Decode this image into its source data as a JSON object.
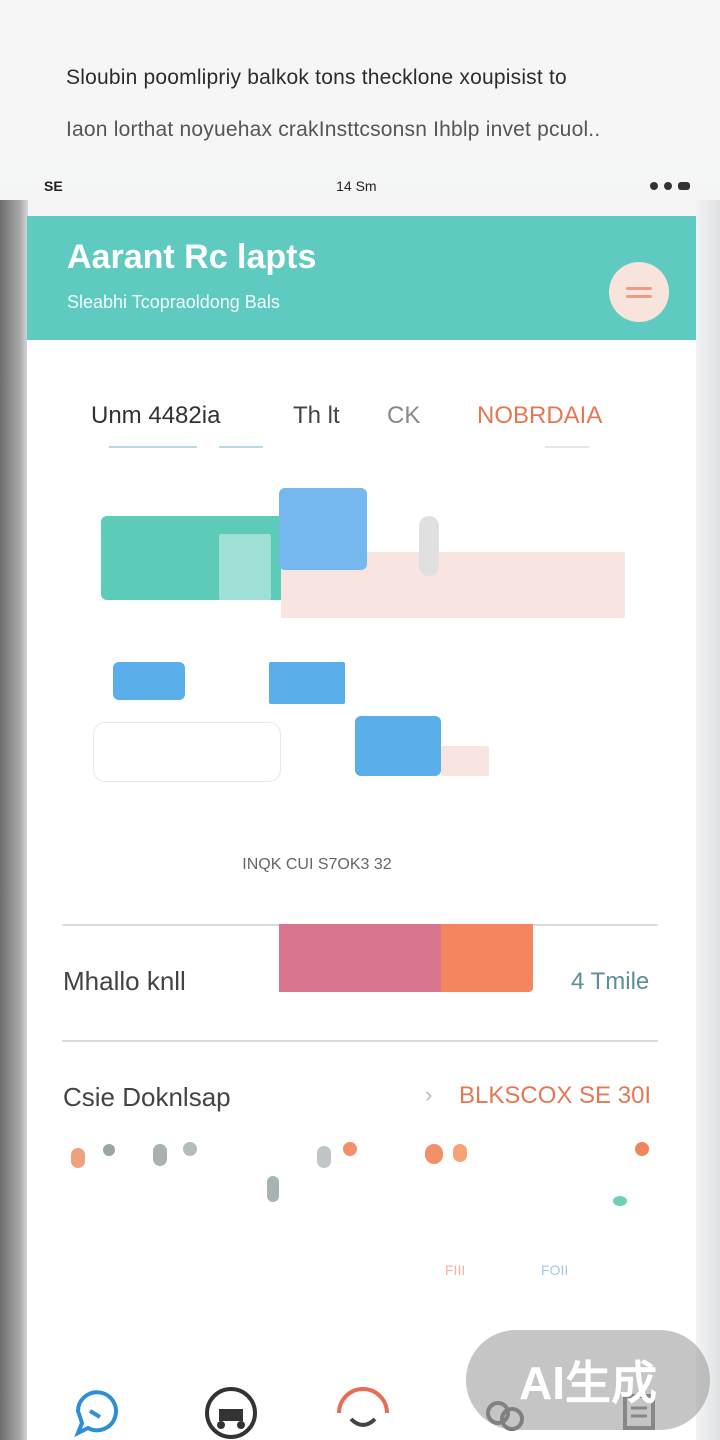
{
  "caption": {
    "line1": "Sloubin poomlipriy balkok tons thecklone xoupisist to",
    "line2": "Iaon lorthat noyuehax crakInsttcsonsn Ihblp invet pcuol.."
  },
  "statusbar": {
    "left": "SE",
    "time": "14 Sm"
  },
  "header": {
    "title": "Aarant Rc lapts",
    "subtitle": "Sleabhi Tcopraoldong Bals",
    "menu_icon": "hamburger-icon"
  },
  "tabs": [
    {
      "label": "Unm 4482ia"
    },
    {
      "label": "Th lt"
    },
    {
      "label": "CK"
    },
    {
      "label": "NOBRDAIA"
    }
  ],
  "summary": "INQK CUI S7OK3 32",
  "rows": [
    {
      "label": "Mhallo knll",
      "value": "4 Tmile"
    },
    {
      "label": "Csie Doknlsap",
      "value": "BLKSCOX SE 30I"
    }
  ],
  "small_tags": [
    "FIII",
    "FOII"
  ],
  "colors": {
    "header": "#5fcac0",
    "accent_orange": "#e57854",
    "blue": "#5aaeea",
    "pink": "#d9758f",
    "teal_bar": "#5ccbb8"
  },
  "nav": [
    {
      "icon": "chat-icon"
    },
    {
      "icon": "scooter-icon"
    },
    {
      "icon": "smile-icon"
    },
    {
      "icon": "group-icon"
    },
    {
      "icon": "document-icon"
    }
  ],
  "watermark": "AI生成"
}
